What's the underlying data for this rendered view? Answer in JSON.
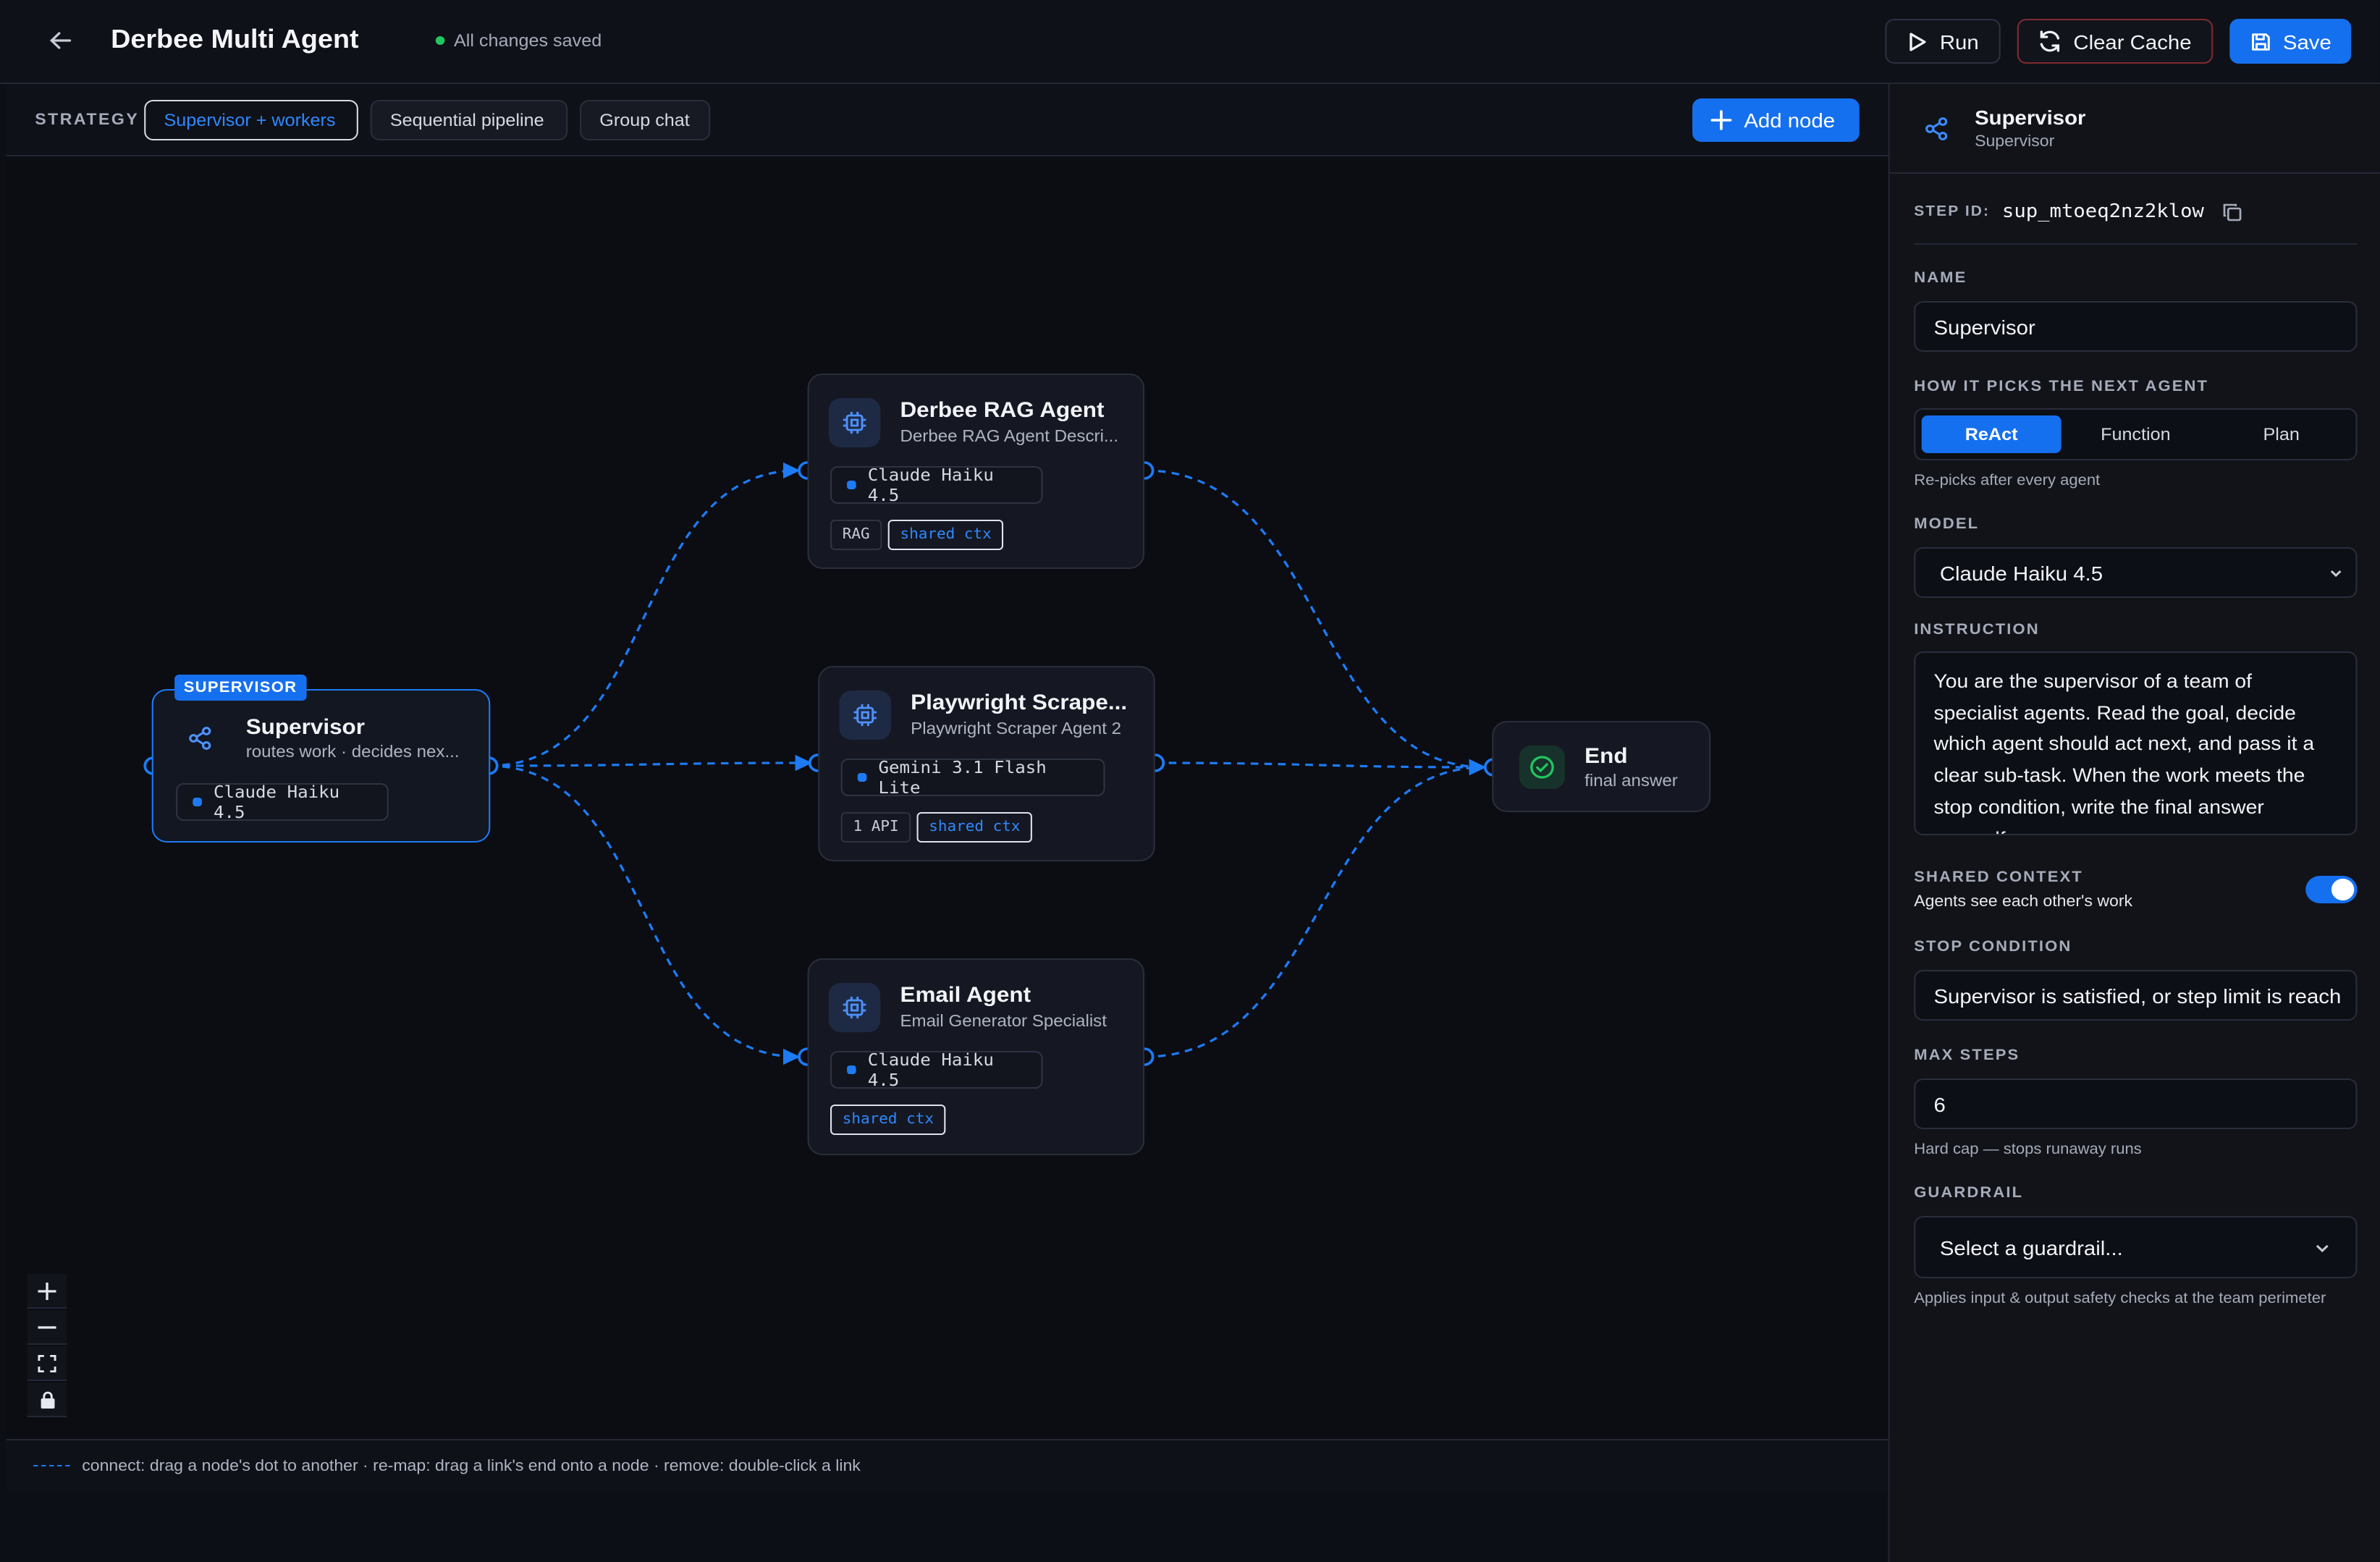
{
  "header": {
    "title": "Derbee Multi Agent",
    "save_status": "All changes saved",
    "run_label": "Run",
    "clear_cache_label": "Clear Cache",
    "save_label": "Save"
  },
  "strategy": {
    "label": "STRATEGY",
    "options": [
      "Supervisor + workers",
      "Sequential pipeline",
      "Group chat"
    ],
    "selected": "Supervisor + workers",
    "add_node_label": "Add node"
  },
  "nodes": {
    "supervisor": {
      "badge": "SUPERVISOR",
      "title": "Supervisor",
      "subtitle": "routes work · decides nex...",
      "model": "Claude Haiku 4.5"
    },
    "rag": {
      "title": "Derbee RAG Agent",
      "subtitle": "Derbee RAG Agent Descri...",
      "model": "Claude Haiku 4.5",
      "tags": [
        "RAG",
        "shared ctx"
      ]
    },
    "scraper": {
      "title": "Playwright Scrape...",
      "subtitle": "Playwright Scraper Agent 2",
      "model": "Gemini 3.1 Flash Lite",
      "tags": [
        "1 API",
        "shared ctx"
      ]
    },
    "email": {
      "title": "Email Agent",
      "subtitle": "Email Generator Specialist",
      "model": "Claude Haiku 4.5",
      "tags": [
        "shared ctx"
      ]
    },
    "end": {
      "title": "End",
      "subtitle": "final answer"
    }
  },
  "hint": "connect: drag a node's dot to another · re-map: drag a link's end onto a node · remove: double-click a link",
  "panel": {
    "title": "Supervisor",
    "subtitle": "Supervisor",
    "step_id_label": "STEP ID:",
    "step_id": "sup_mtoeq2nz2klow",
    "name_label": "NAME",
    "name_value": "Supervisor",
    "picks_label": "HOW IT PICKS THE NEXT AGENT",
    "picks_options": [
      "ReAct",
      "Function",
      "Plan"
    ],
    "picks_selected": "ReAct",
    "picks_help": "Re-picks after every agent",
    "model_label": "MODEL",
    "model_value": "Claude Haiku 4.5",
    "instruction_label": "INSTRUCTION",
    "instruction_value": "You are the supervisor of a team of specialist agents. Read the goal, decide which agent should act next, and pass it a clear sub-task. When the work meets the stop condition, write the final answer yourself.",
    "shared_context_label": "SHARED CONTEXT",
    "shared_context_help": "Agents see each other's work",
    "shared_context_on": true,
    "stop_label": "STOP CONDITION",
    "stop_value": "Supervisor is satisfied, or step limit is reach",
    "max_steps_label": "MAX STEPS",
    "max_steps_value": "6",
    "max_steps_help": "Hard cap — stops runaway runs",
    "guardrail_label": "GUARDRAIL",
    "guardrail_placeholder": "Select a guardrail...",
    "guardrail_help": "Applies input & output safety checks at the team perimeter"
  },
  "colors": {
    "accent": "#1570ef",
    "edge": "#1d7bf5",
    "success": "#22c55e",
    "danger_border": "#7f2a30"
  }
}
